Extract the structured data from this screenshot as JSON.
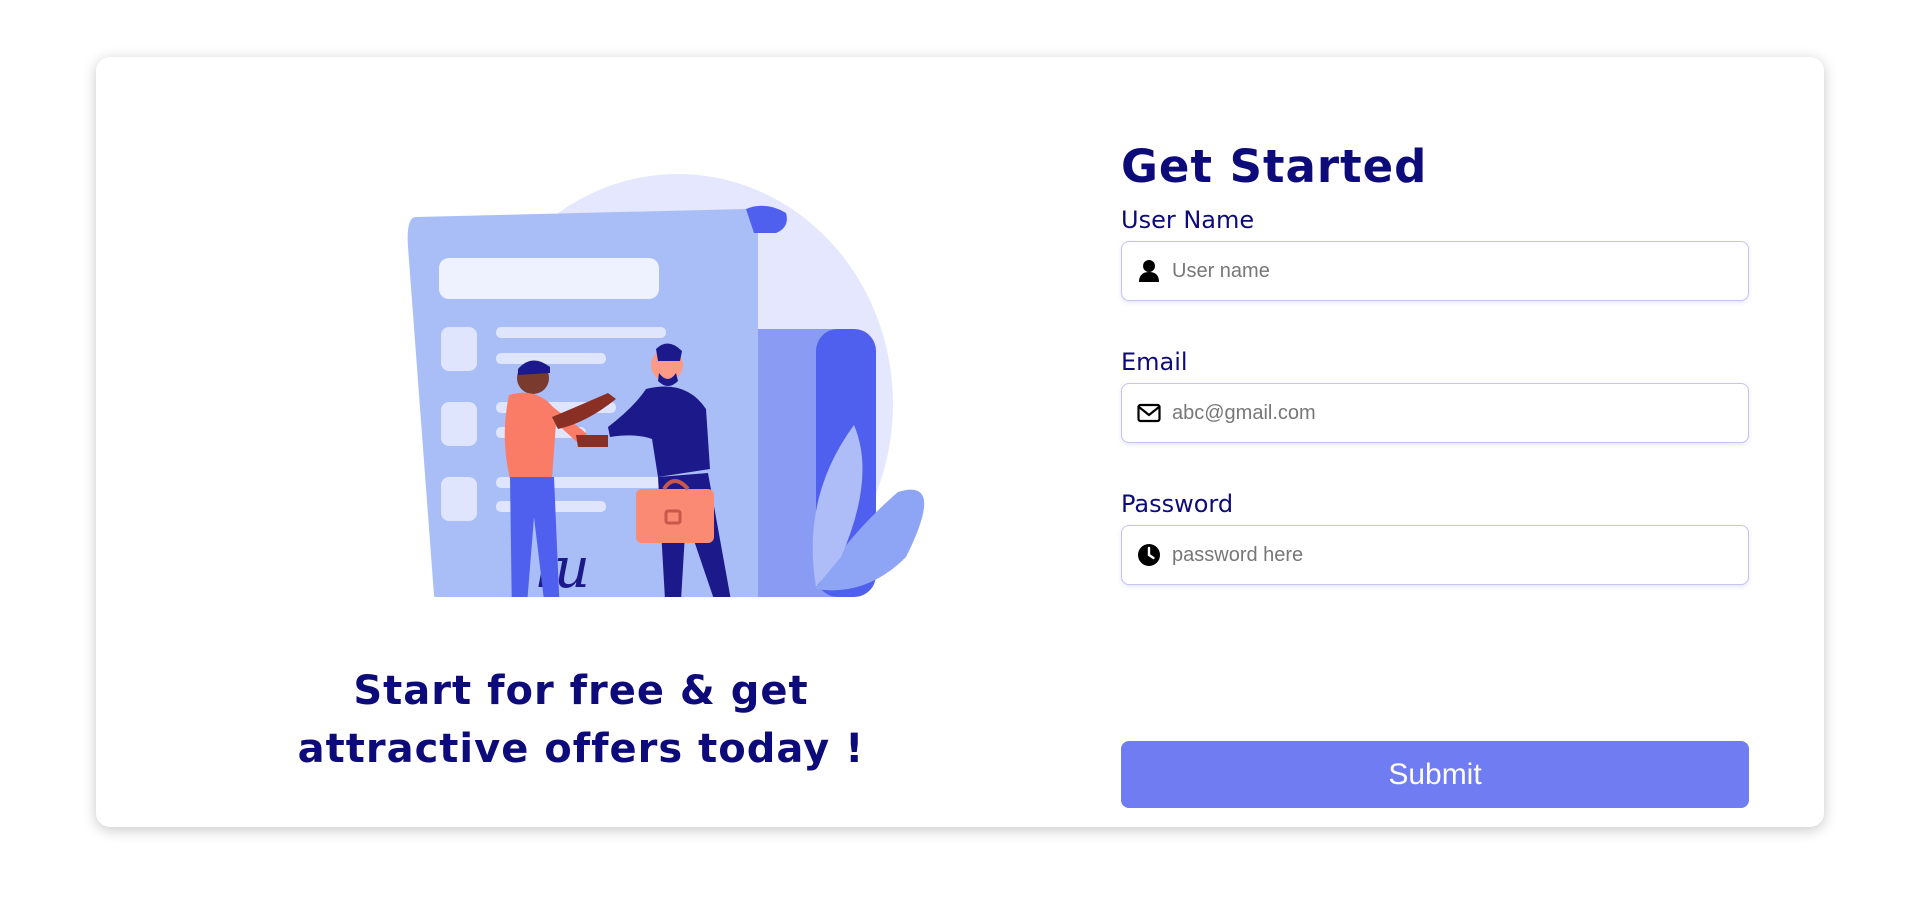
{
  "promo": {
    "tagline_line1": "Start for free & get",
    "tagline_line2": "attractive offers today !",
    "signature": "lu"
  },
  "form": {
    "title": "Get Started",
    "username": {
      "label": "User Name",
      "placeholder": "User name",
      "icon": "user-icon",
      "value": ""
    },
    "email": {
      "label": "Email",
      "placeholder": "abc@gmail.com",
      "icon": "envelope-icon",
      "value": ""
    },
    "password": {
      "label": "Password",
      "placeholder": "password here",
      "icon": "clock-icon",
      "value": ""
    },
    "submit_label": "Submit"
  },
  "colors": {
    "accent": "#6f7cf2",
    "heading": "#0d0a7a",
    "input_border": "#c6c3ef"
  }
}
